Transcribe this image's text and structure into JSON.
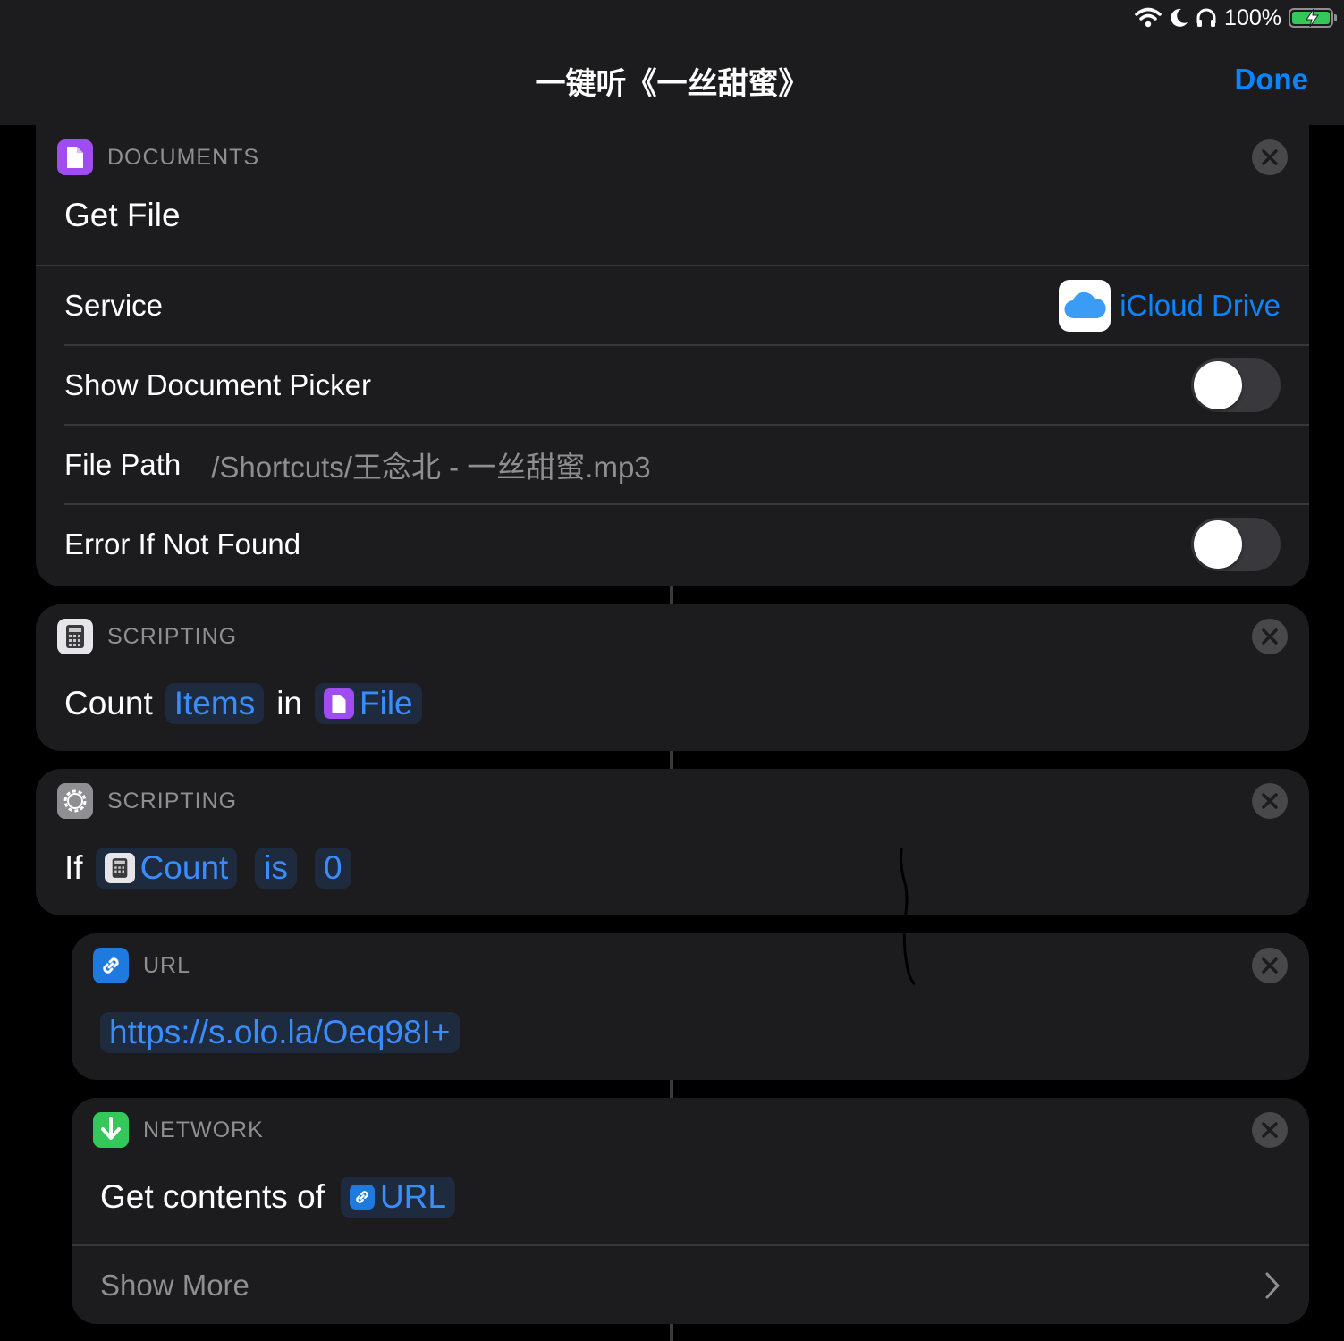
{
  "status_bar": {
    "battery": "100%",
    "battery_level": 1.0
  },
  "nav": {
    "title": "一键听《一丝甜蜜》",
    "done_label": "Done"
  },
  "colors": {
    "accent": "#0a84ff",
    "documents": "#a14cf0",
    "url": "#1f7ae0",
    "network": "#34c759",
    "scripting": "#8e8e93"
  },
  "get_file": {
    "category": "DOCUMENTS",
    "title": "Get File",
    "service_label": "Service",
    "service_value": "iCloud Drive",
    "show_picker_label": "Show Document Picker",
    "show_picker_on": false,
    "file_path_label": "File Path",
    "file_path_value": "/Shortcuts/王念北 - 一丝甜蜜.mp3",
    "error_label": "Error If Not Found",
    "error_on": false
  },
  "count": {
    "category": "SCRIPTING",
    "verb": "Count",
    "items_token": "Items",
    "in_word": "in",
    "file_token": "File"
  },
  "if_block": {
    "category": "SCRIPTING",
    "if_word": "If",
    "count_token": "Count",
    "is_token": "is",
    "value_token": "0"
  },
  "url_block": {
    "category": "URL",
    "url": "https://s.olo.la/Oeq98I+"
  },
  "network": {
    "category": "NETWORK",
    "action": "Get contents of",
    "url_token": "URL",
    "show_more": "Show More"
  }
}
